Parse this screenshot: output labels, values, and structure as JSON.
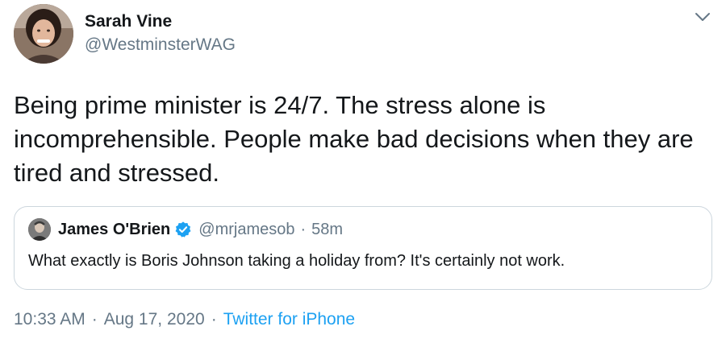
{
  "author": {
    "display_name": "Sarah Vine",
    "handle": "@WestminsterWAG",
    "avatar_icon": "profile-photo"
  },
  "menu": {
    "icon": "chevron-down-icon"
  },
  "tweet": {
    "text": "Being prime minister is 24/7. The stress alone is incomprehensible. People make bad decisions when they are tired and stressed."
  },
  "quoted": {
    "display_name": "James O'Brien",
    "verified": true,
    "handle": "@mrjamesob",
    "separator": "·",
    "time": "58m",
    "text": "What exactly is Boris Johnson taking a holiday from? It's certainly not work."
  },
  "meta": {
    "time": "10:33 AM",
    "separator": "·",
    "date": "Aug 17, 2020",
    "source": "Twitter for iPhone"
  },
  "colors": {
    "link": "#1da1f2",
    "secondary": "#657786",
    "text": "#14171a",
    "border": "#ccd6dd"
  }
}
